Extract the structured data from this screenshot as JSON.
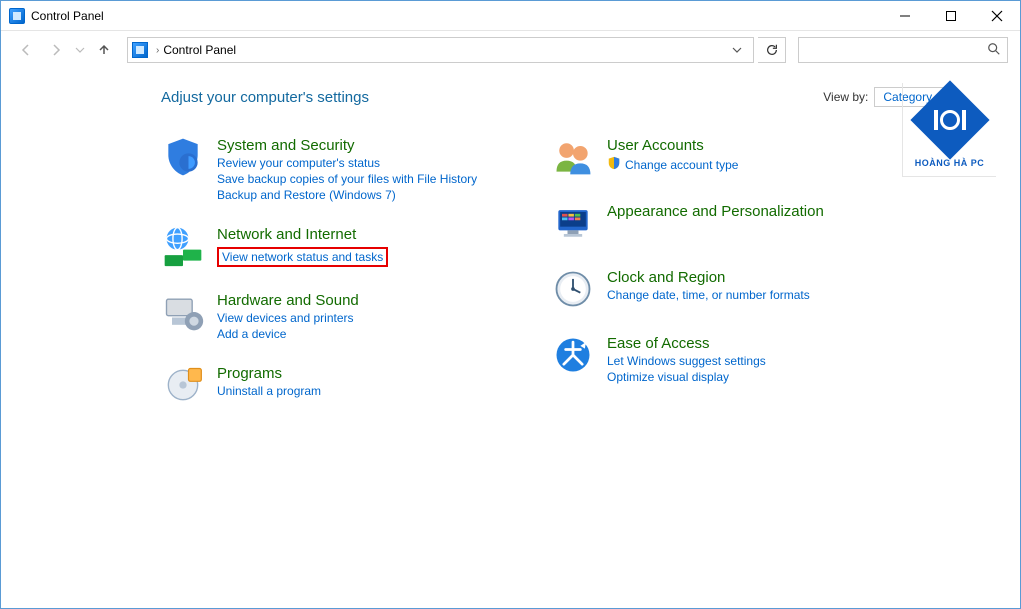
{
  "window": {
    "title": "Control Panel"
  },
  "address": {
    "text": "Control Panel"
  },
  "search": {
    "placeholder": ""
  },
  "page": {
    "heading": "Adjust your computer's settings",
    "viewby_label": "View by:",
    "viewby_value": "Category"
  },
  "left_cats": [
    {
      "title": "System and Security",
      "links": [
        "Review your computer's status",
        "Save backup copies of your files with File History",
        "Backup and Restore (Windows 7)"
      ]
    },
    {
      "title": "Network and Internet",
      "links": [
        "View network status and tasks"
      ],
      "highlight_first": true
    },
    {
      "title": "Hardware and Sound",
      "links": [
        "View devices and printers",
        "Add a device"
      ]
    },
    {
      "title": "Programs",
      "links": [
        "Uninstall a program"
      ]
    }
  ],
  "right_cats": [
    {
      "title": "User Accounts",
      "links": [
        "Change account type"
      ],
      "shield_first": true
    },
    {
      "title": "Appearance and Personalization",
      "links": []
    },
    {
      "title": "Clock and Region",
      "links": [
        "Change date, time, or number formats"
      ]
    },
    {
      "title": "Ease of Access",
      "links": [
        "Let Windows suggest settings",
        "Optimize visual display"
      ]
    }
  ],
  "logo": {
    "text": "HOÀNG HÀ PC"
  }
}
